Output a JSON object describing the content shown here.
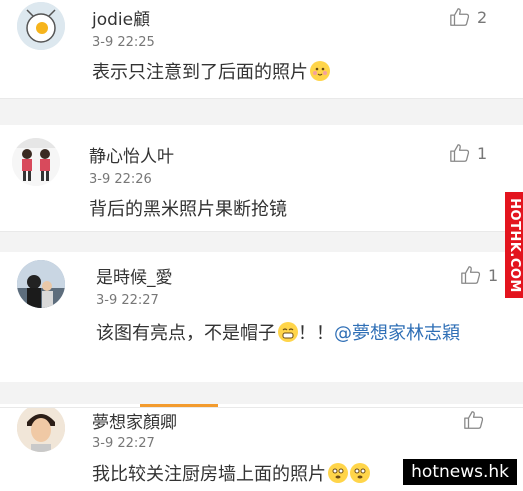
{
  "comments": [
    {
      "name": "jodie顧",
      "time": "3-9 22:25",
      "text": "表示只注意到了后面的照片",
      "likes": "2",
      "avatar": "fried-egg-avatar"
    },
    {
      "name": "静心怡人叶",
      "time": "3-9 22:26",
      "text": "背后的黑米照片果断抢镜",
      "likes": "1",
      "avatar": "two-girls-avatar"
    },
    {
      "name": "是時候_愛",
      "time": "3-9 22:27",
      "text_before": "该图有亮点，不是帽子",
      "text_after": "！！",
      "mention": "@夢想家林志穎",
      "likes": "1",
      "avatar": "couple-avatar"
    },
    {
      "name": "夢想家顏卿",
      "time": "3-9 22:27",
      "text": "我比较关注厨房墙上面的照片",
      "likes": "",
      "avatar": "portrait-avatar"
    }
  ],
  "side_tag": "HOTHK.COM",
  "watermark": "hotnews.hk",
  "colors": {
    "mention": "#2f6fb6",
    "side_tag_bg": "#e3141e",
    "accent_bar": "#f39b2d",
    "emoji_yellow": "#ffd54a"
  }
}
